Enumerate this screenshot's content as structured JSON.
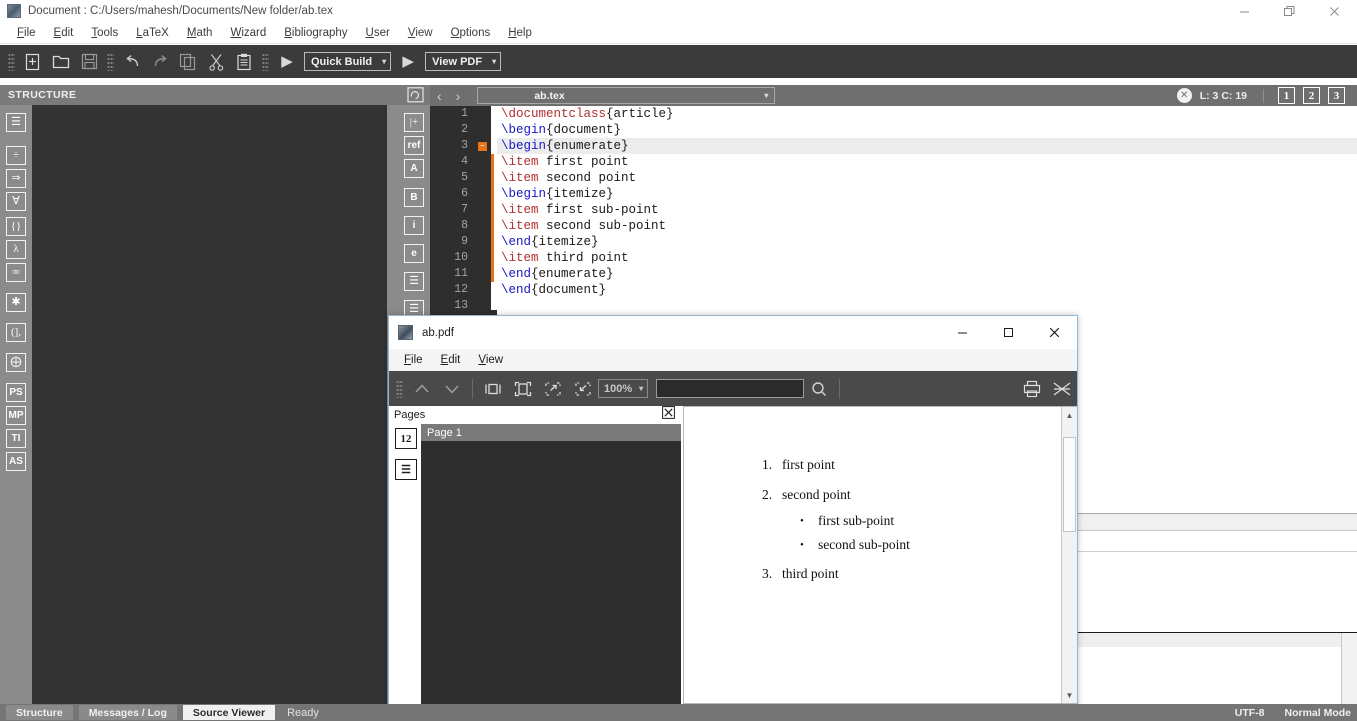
{
  "app": {
    "title": "Document : C:/Users/mahesh/Documents/New folder/ab.tex",
    "window_icon": "texstudio-icon",
    "minimize": "—",
    "maximize": "❐",
    "close": "✕"
  },
  "menubar": {
    "items": [
      {
        "label": "File",
        "mnemonic": "F"
      },
      {
        "label": "Edit",
        "mnemonic": "E"
      },
      {
        "label": "Tools",
        "mnemonic": "T"
      },
      {
        "label": "LaTeX",
        "mnemonic": "L"
      },
      {
        "label": "Math",
        "mnemonic": "M"
      },
      {
        "label": "Wizard",
        "mnemonic": "W"
      },
      {
        "label": "Bibliography",
        "mnemonic": "B"
      },
      {
        "label": "User",
        "mnemonic": "U"
      },
      {
        "label": "View",
        "mnemonic": "V"
      },
      {
        "label": "Options",
        "mnemonic": "O"
      },
      {
        "label": "Help",
        "mnemonic": "H"
      }
    ]
  },
  "toolbar": {
    "buttons": [
      {
        "name": "new-file-icon"
      },
      {
        "name": "open-folder-icon"
      },
      {
        "name": "save-icon"
      },
      {
        "name": "undo-icon"
      },
      {
        "name": "redo-icon"
      },
      {
        "name": "copy-icon"
      },
      {
        "name": "cut-icon"
      },
      {
        "name": "paste-icon"
      }
    ],
    "build_run_label": "▶",
    "quick_build_label": "Quick Build",
    "view_run_label": "▶",
    "view_pdf_label": "View PDF",
    "caret": "▾"
  },
  "structure": {
    "title": "STRUCTURE",
    "refresh_icon": "refresh-icon",
    "left_icons": [
      {
        "name": "list-icon",
        "glyph": "☰"
      },
      {
        "name": "division-icon",
        "glyph": "÷"
      },
      {
        "name": "implies-icon",
        "glyph": "⇒"
      },
      {
        "name": "forall-icon",
        "glyph": "∀"
      },
      {
        "name": "braces-icon",
        "glyph": "{}"
      },
      {
        "name": "lambda-icon",
        "glyph": "λ"
      },
      {
        "name": "infinity-icon",
        "glyph": "∞"
      },
      {
        "name": "asterisk-icon",
        "glyph": "✱"
      },
      {
        "name": "brackets-icon",
        "glyph": "(],"
      },
      {
        "name": "person-icon",
        "glyph": "⨁"
      },
      {
        "name": "postscript-icon",
        "glyph": "PS"
      },
      {
        "name": "metapost-icon",
        "glyph": "MP"
      },
      {
        "name": "tikz-icon",
        "glyph": "TI"
      },
      {
        "name": "asymptote-icon",
        "glyph": "AS"
      }
    ],
    "right_icons": [
      {
        "name": "insert-label-icon",
        "glyph": "|+"
      },
      {
        "name": "insert-ref-icon",
        "glyph": "ref"
      },
      {
        "name": "font-size-icon",
        "glyph": "A"
      },
      {
        "name": "bold-icon",
        "glyph": "B"
      },
      {
        "name": "italic-icon",
        "glyph": "i"
      },
      {
        "name": "emphasis-icon",
        "glyph": "e"
      },
      {
        "name": "align-center-icon",
        "glyph": "☰"
      },
      {
        "name": "align-left-icon",
        "glyph": "☰"
      }
    ]
  },
  "editor": {
    "nav_back": "‹",
    "nav_forward": "›",
    "tab_label": "ab.tex",
    "tab_caret": "▾",
    "close_icon": "✕",
    "cursor_position": "L: 3 C: 19",
    "view_buttons": [
      "1",
      "2",
      "3"
    ],
    "active_line": 3,
    "lines": [
      {
        "n": "1",
        "fold": false,
        "bracket": false,
        "tokens": [
          {
            "t": "\\documentclass",
            "c": "cmd"
          },
          {
            "t": "{article}",
            "c": ""
          }
        ]
      },
      {
        "n": "2",
        "fold": false,
        "bracket": false,
        "tokens": [
          {
            "t": "\\begin",
            "c": "kw"
          },
          {
            "t": "{document}",
            "c": ""
          }
        ]
      },
      {
        "n": "3",
        "fold": true,
        "bracket": false,
        "tokens": [
          {
            "t": "\\begin",
            "c": "kw"
          },
          {
            "t": "{enumerate}",
            "c": ""
          }
        ]
      },
      {
        "n": "4",
        "fold": false,
        "bracket": true,
        "tokens": [
          {
            "t": "\\item",
            "c": "cmd"
          },
          {
            "t": " first point",
            "c": ""
          }
        ]
      },
      {
        "n": "5",
        "fold": false,
        "bracket": true,
        "tokens": [
          {
            "t": "\\item",
            "c": "cmd"
          },
          {
            "t": " second point",
            "c": ""
          }
        ]
      },
      {
        "n": "6",
        "fold": false,
        "bracket": true,
        "tokens": [
          {
            "t": "\\begin",
            "c": "kw"
          },
          {
            "t": "{itemize}",
            "c": ""
          }
        ]
      },
      {
        "n": "7",
        "fold": false,
        "bracket": true,
        "tokens": [
          {
            "t": "\\item",
            "c": "cmd"
          },
          {
            "t": " first sub-point",
            "c": ""
          }
        ]
      },
      {
        "n": "8",
        "fold": false,
        "bracket": true,
        "tokens": [
          {
            "t": "\\item",
            "c": "cmd"
          },
          {
            "t": " second sub-point",
            "c": ""
          }
        ]
      },
      {
        "n": "9",
        "fold": false,
        "bracket": true,
        "tokens": [
          {
            "t": "\\end",
            "c": "kw"
          },
          {
            "t": "{itemize}",
            "c": ""
          }
        ]
      },
      {
        "n": "10",
        "fold": false,
        "bracket": true,
        "tokens": [
          {
            "t": "\\item",
            "c": "cmd"
          },
          {
            "t": " third point",
            "c": ""
          }
        ]
      },
      {
        "n": "11",
        "fold": false,
        "bracket": true,
        "tokens": [
          {
            "t": "\\end",
            "c": "kw"
          },
          {
            "t": "{enumerate}",
            "c": ""
          }
        ]
      },
      {
        "n": "12",
        "fold": false,
        "bracket": false,
        "tokens": [
          {
            "t": "\\end",
            "c": "kw"
          },
          {
            "t": "{document}",
            "c": ""
          }
        ]
      },
      {
        "n": "13",
        "fold": false,
        "bracket": false,
        "tokens": []
      }
    ]
  },
  "statusbar": {
    "tabs": [
      {
        "label": "Structure",
        "active": false
      },
      {
        "label": "Messages / Log",
        "active": false
      },
      {
        "label": "Source Viewer",
        "active": true
      }
    ],
    "ready": "Ready",
    "encoding": "UTF-8",
    "mode": "Normal Mode"
  },
  "pdf_window": {
    "title": "ab.pdf",
    "icon": "pdf-document-icon",
    "minimize": "—",
    "maximize": "☐",
    "close": "✕",
    "menu": [
      {
        "label": "File",
        "mnemonic": "F"
      },
      {
        "label": "Edit",
        "mnemonic": "E"
      },
      {
        "label": "View",
        "mnemonic": "V"
      }
    ],
    "toolbar": {
      "prev_page": "prev-page-icon",
      "next_page": "next-page-icon",
      "fit_width": "fit-width-icon",
      "fit_page": "fit-page-icon",
      "zoom_in": "zoom-in-icon",
      "zoom_out": "zoom-out-icon",
      "zoom_value": "100%",
      "zoom_caret": "▾",
      "search_value": "",
      "search_placeholder": "",
      "search_icon": "search-icon",
      "print_icon": "print-icon",
      "sync_icon": "sync-icon"
    },
    "pages_panel": {
      "label": "Pages",
      "close_icon": "☒",
      "side_icons": [
        {
          "name": "page-numbers-icon",
          "glyph": "12"
        },
        {
          "name": "outline-icon",
          "glyph": "☰"
        }
      ],
      "entries": [
        "Page 1"
      ]
    },
    "document": {
      "items": [
        {
          "marker": "1.",
          "text": "first point",
          "sub": []
        },
        {
          "marker": "2.",
          "text": "second point",
          "sub": [
            {
              "marker": "•",
              "text": "first sub-point"
            },
            {
              "marker": "•",
              "text": "second sub-point"
            }
          ]
        },
        {
          "marker": "3.",
          "text": "third point",
          "sub": []
        }
      ]
    },
    "scroll_up": "▲",
    "scroll_down": "▼",
    "hscroll_down": "▾"
  }
}
